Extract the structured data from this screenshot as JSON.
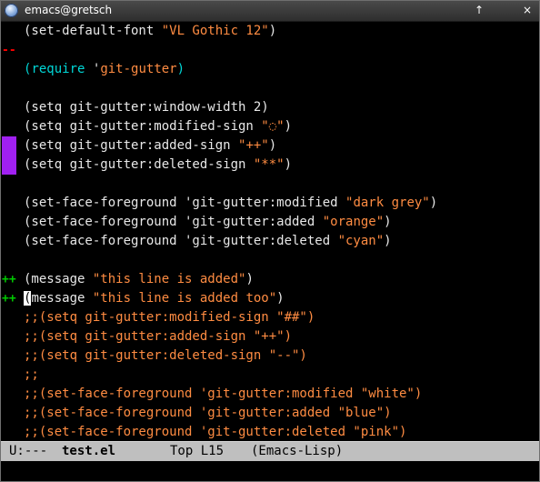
{
  "window": {
    "title": "emacs@gretsch",
    "controls": {
      "maximize": "↑",
      "close": "×"
    }
  },
  "colors": {
    "fringe_modified": "#a020f0",
    "sign_added": "#00cc00",
    "sign_deleted": "#ff0000",
    "string": "#ff8c42",
    "keyword": "#00d7d7",
    "default": "#e8e8e8"
  },
  "lines": [
    {
      "fringe": "",
      "text": ""
    },
    {
      "fringe": "deleted",
      "text": ""
    },
    {
      "fringe": "",
      "text": ""
    },
    {
      "fringe": "",
      "text": ""
    },
    {
      "fringe": "",
      "text": ""
    },
    {
      "fringe": "",
      "text": ""
    },
    {
      "fringe": "modified",
      "text": ""
    },
    {
      "fringe": "modified",
      "text": ""
    },
    {
      "fringe": "",
      "text": ""
    },
    {
      "fringe": "",
      "text": ""
    },
    {
      "fringe": "",
      "text": ""
    },
    {
      "fringe": "",
      "text": ""
    },
    {
      "fringe": "",
      "text": ""
    },
    {
      "fringe": "added",
      "text": ""
    },
    {
      "fringe": "added",
      "text": ""
    },
    {
      "fringe": "",
      "text": ""
    },
    {
      "fringe": "",
      "text": ""
    },
    {
      "fringe": "",
      "text": ""
    },
    {
      "fringe": "",
      "text": ""
    },
    {
      "fringe": "",
      "text": ""
    },
    {
      "fringe": "",
      "text": ""
    },
    {
      "fringe": "",
      "text": ""
    }
  ],
  "code": {
    "l1_a": "(set-default-font ",
    "l1_b": "\"VL Gothic 12\"",
    "l1_c": ")",
    "l3_a": "(",
    "l3_b": "require",
    "l3_c": " '",
    "l3_d": "git-gutter",
    "l3_e": ")",
    "l5": "(setq git-gutter:window-width 2)",
    "l6_a": "(setq git-gutter:modified-sign ",
    "l6_b": "\"◌\"",
    "l6_c": ")",
    "l7_a": "(setq git-gutter:added-sign ",
    "l7_b": "\"++\"",
    "l7_c": ")",
    "l8_a": "(setq git-gutter:deleted-sign ",
    "l8_b": "\"**\"",
    "l8_c": ")",
    "l10_a": "(set-face-foreground 'git-gutter:modified ",
    "l10_b": "\"dark grey\"",
    "l10_c": ")",
    "l11_a": "(set-face-foreground 'git-gutter:added ",
    "l11_b": "\"orange\"",
    "l11_c": ")",
    "l12_a": "(set-face-foreground 'git-gutter:deleted ",
    "l12_b": "\"cyan\"",
    "l12_c": ")",
    "l14_a": "(message ",
    "l14_b": "\"this line is added\"",
    "l14_c": ")",
    "l15_cursor": "(",
    "l15_a": "message ",
    "l15_b": "\"this line is added too\"",
    "l15_c": ")",
    "l16": ";;(setq git-gutter:modified-sign \"##\")",
    "l17": ";;(setq git-gutter:added-sign \"++\")",
    "l18": ";;(setq git-gutter:deleted-sign \"--\")",
    "l19": ";;",
    "l20": ";;(set-face-foreground 'git-gutter:modified \"white\")",
    "l21": ";;(set-face-foreground 'git-gutter:added \"blue\")",
    "l22": ";;(set-face-foreground 'git-gutter:deleted \"pink\")"
  },
  "signs": {
    "added": "++",
    "deleted": "--"
  },
  "modeline": {
    "status": "U:---",
    "buffer": "test.el",
    "position": "Top L15",
    "mode": "(Emacs-Lisp)"
  },
  "minibuffer": {
    "text": ""
  }
}
